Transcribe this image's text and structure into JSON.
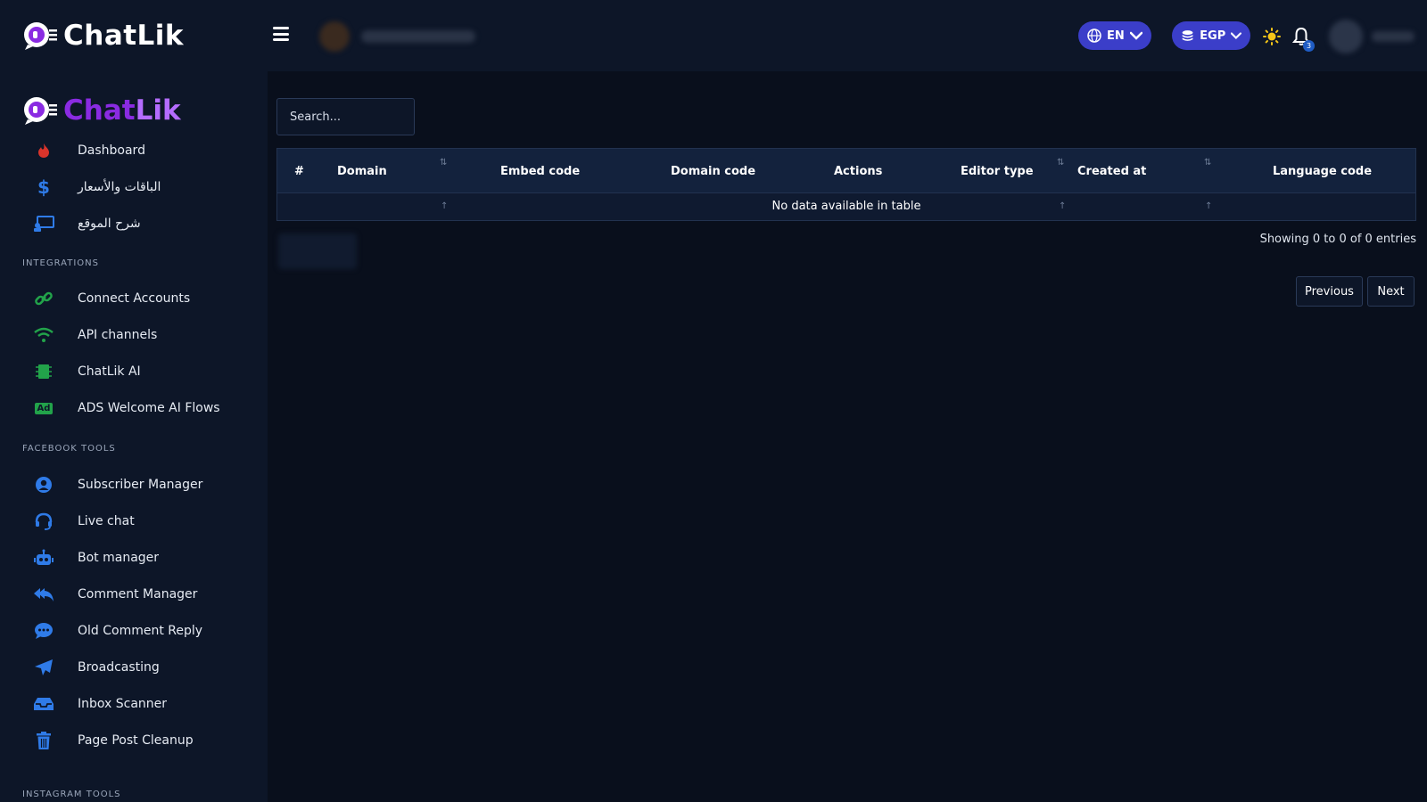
{
  "header": {
    "brand": "ChatLik",
    "language": "EN",
    "currency": "EGP",
    "notification_count": "3"
  },
  "sidebar": {
    "brand_part1": "Chat",
    "brand_part2": "Lik",
    "main_items": [
      {
        "label": "Dashboard",
        "icon": "fire-icon"
      },
      {
        "label": "الباقات والأسعار",
        "icon": "dollar-icon"
      },
      {
        "label": "شرح الموقع",
        "icon": "presentation-icon"
      }
    ],
    "integrations_label": "INTEGRATIONS",
    "integrations": [
      {
        "label": "Connect Accounts",
        "icon": "link-icon"
      },
      {
        "label": "API channels",
        "icon": "wifi-icon"
      },
      {
        "label": "ChatLik AI",
        "icon": "chip-icon"
      },
      {
        "label": "ADS Welcome AI Flows",
        "icon": "ad-icon"
      }
    ],
    "facebook_label": "FACEBOOK TOOLS",
    "facebook": [
      {
        "label": "Subscriber Manager",
        "icon": "user-circle-icon"
      },
      {
        "label": "Live chat",
        "icon": "headset-icon"
      },
      {
        "label": "Bot manager",
        "icon": "robot-icon"
      },
      {
        "label": "Comment Manager",
        "icon": "reply-all-icon"
      },
      {
        "label": "Old Comment Reply",
        "icon": "comment-dots-icon"
      },
      {
        "label": "Broadcasting",
        "icon": "paper-plane-icon"
      },
      {
        "label": "Inbox Scanner",
        "icon": "inbox-icon"
      },
      {
        "label": "Page Post Cleanup",
        "icon": "trash-icon"
      }
    ],
    "instagram_label": "INSTAGRAM TOOLS"
  },
  "main": {
    "search_placeholder": "Search...",
    "columns": [
      "#",
      "Domain",
      "Embed code",
      "Domain code",
      "Actions",
      "Editor type",
      "Created at",
      "Language code"
    ],
    "empty_message": "No data available in table",
    "info": "Showing 0 to 0 of 0 entries",
    "prev_label": "Previous",
    "next_label": "Next"
  },
  "colors": {
    "accent": "#3b3ec9",
    "brand_purple": "#8a2be2",
    "sidebar_bg": "#0d1628",
    "page_bg": "#090f1c"
  }
}
